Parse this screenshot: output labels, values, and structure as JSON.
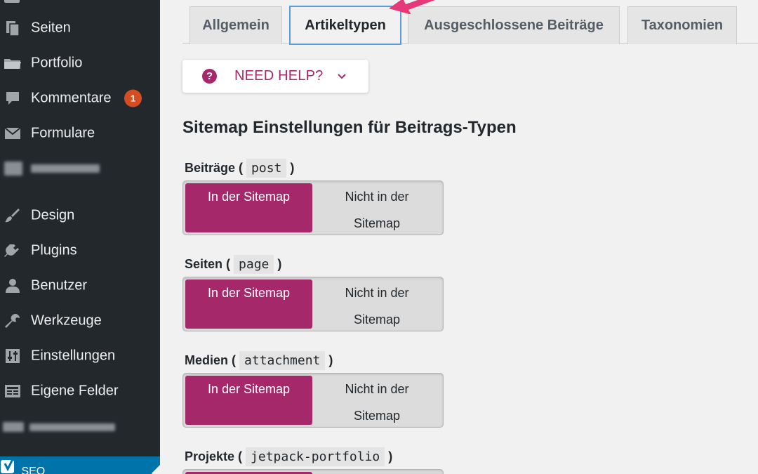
{
  "sidebar": {
    "items": [
      {
        "label": "Seiten",
        "icon": "pages-icon"
      },
      {
        "label": "Portfolio",
        "icon": "portfolio-folder-icon"
      },
      {
        "label": "Kommentare",
        "icon": "comment-bubble-icon",
        "badge": "1"
      },
      {
        "label": "Formulare",
        "icon": "envelope-icon"
      },
      {
        "label": "Design",
        "icon": "brush-icon"
      },
      {
        "label": "Plugins",
        "icon": "plug-icon"
      },
      {
        "label": "Benutzer",
        "icon": "user-icon"
      },
      {
        "label": "Werkzeuge",
        "icon": "wrench-icon"
      },
      {
        "label": "Einstellungen",
        "icon": "settings-sliders-icon"
      },
      {
        "label": "Eigene Felder",
        "icon": "custom-fields-icon"
      },
      {
        "label": "SEO",
        "icon": "yoast-icon"
      }
    ]
  },
  "tabs": [
    {
      "label": "Allgemein",
      "active": false
    },
    {
      "label": "Artikeltypen",
      "active": true
    },
    {
      "label": "Ausgeschlossene Beiträge",
      "active": false
    },
    {
      "label": "Taxonomien",
      "active": false
    }
  ],
  "help": {
    "label": "NEED HELP?",
    "icon": "question-circle-icon",
    "chevron": "chevron-down-icon"
  },
  "section_title": "Sitemap Einstellungen für Beitrags-Typen",
  "post_types": [
    {
      "name": "Beiträge (",
      "slug": "post",
      "close": ")",
      "on_label": "In der Sitemap",
      "off_label_1": "Nicht in der",
      "off_label_2": "Sitemap",
      "selected": "on"
    },
    {
      "name": "Seiten (",
      "slug": "page",
      "close": ")",
      "on_label": "In der Sitemap",
      "off_label_1": "Nicht in der",
      "off_label_2": "Sitemap",
      "selected": "on"
    },
    {
      "name": "Medien (",
      "slug": "attachment",
      "close": ")",
      "on_label": "In der Sitemap",
      "off_label_1": "Nicht in der",
      "off_label_2": "Sitemap",
      "selected": "on"
    },
    {
      "name": "Projekte (",
      "slug": "jetpack-portfolio",
      "close": ")",
      "selected": "on"
    }
  ],
  "colors": {
    "accent": "#a4286a",
    "sidebar_bg": "#23282d",
    "seo_active": "#0073aa",
    "badge": "#d54e21",
    "pointer": "#e6397a"
  }
}
